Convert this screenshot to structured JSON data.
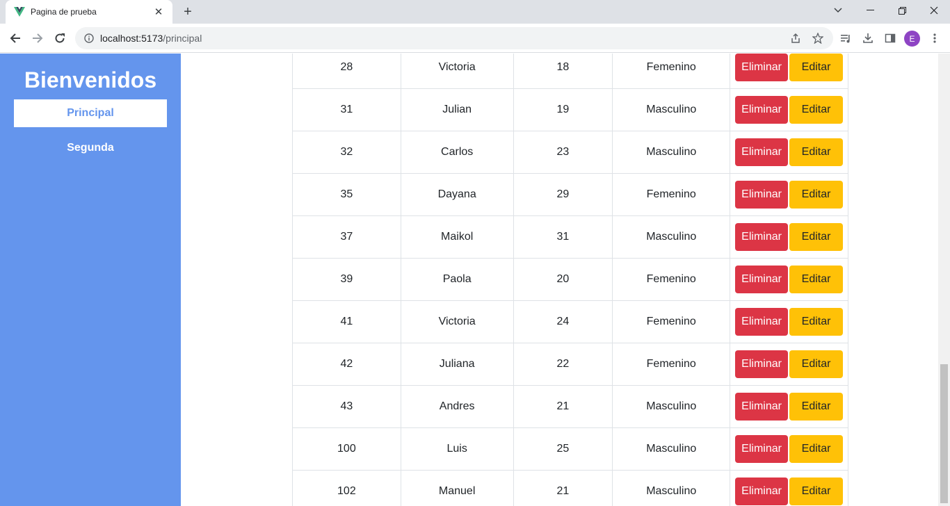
{
  "browser": {
    "tab_title": "Pagina de prueba",
    "url_host": "localhost:5173",
    "url_path": "/principal",
    "avatar_letter": "E"
  },
  "sidebar": {
    "title": "Bienvenidos",
    "items": [
      {
        "label": "Principal",
        "active": true
      },
      {
        "label": "Segunda",
        "active": false
      }
    ]
  },
  "table": {
    "delete_label": "Eliminar",
    "edit_label": "Editar",
    "rows": [
      {
        "id": "28",
        "name": "Victoria",
        "age": "18",
        "gender": "Femenino"
      },
      {
        "id": "31",
        "name": "Julian",
        "age": "19",
        "gender": "Masculino"
      },
      {
        "id": "32",
        "name": "Carlos",
        "age": "23",
        "gender": "Masculino"
      },
      {
        "id": "35",
        "name": "Dayana",
        "age": "29",
        "gender": "Femenino"
      },
      {
        "id": "37",
        "name": "Maikol",
        "age": "31",
        "gender": "Masculino"
      },
      {
        "id": "39",
        "name": "Paola",
        "age": "20",
        "gender": "Femenino"
      },
      {
        "id": "41",
        "name": "Victoria",
        "age": "24",
        "gender": "Femenino"
      },
      {
        "id": "42",
        "name": "Juliana",
        "age": "22",
        "gender": "Femenino"
      },
      {
        "id": "43",
        "name": "Andres",
        "age": "21",
        "gender": "Masculino"
      },
      {
        "id": "100",
        "name": "Luis",
        "age": "25",
        "gender": "Masculino"
      },
      {
        "id": "102",
        "name": "Manuel",
        "age": "21",
        "gender": "Masculino"
      }
    ]
  },
  "colors": {
    "sidebar": "#6495ed",
    "delete": "#dc3545",
    "edit": "#ffc107"
  }
}
